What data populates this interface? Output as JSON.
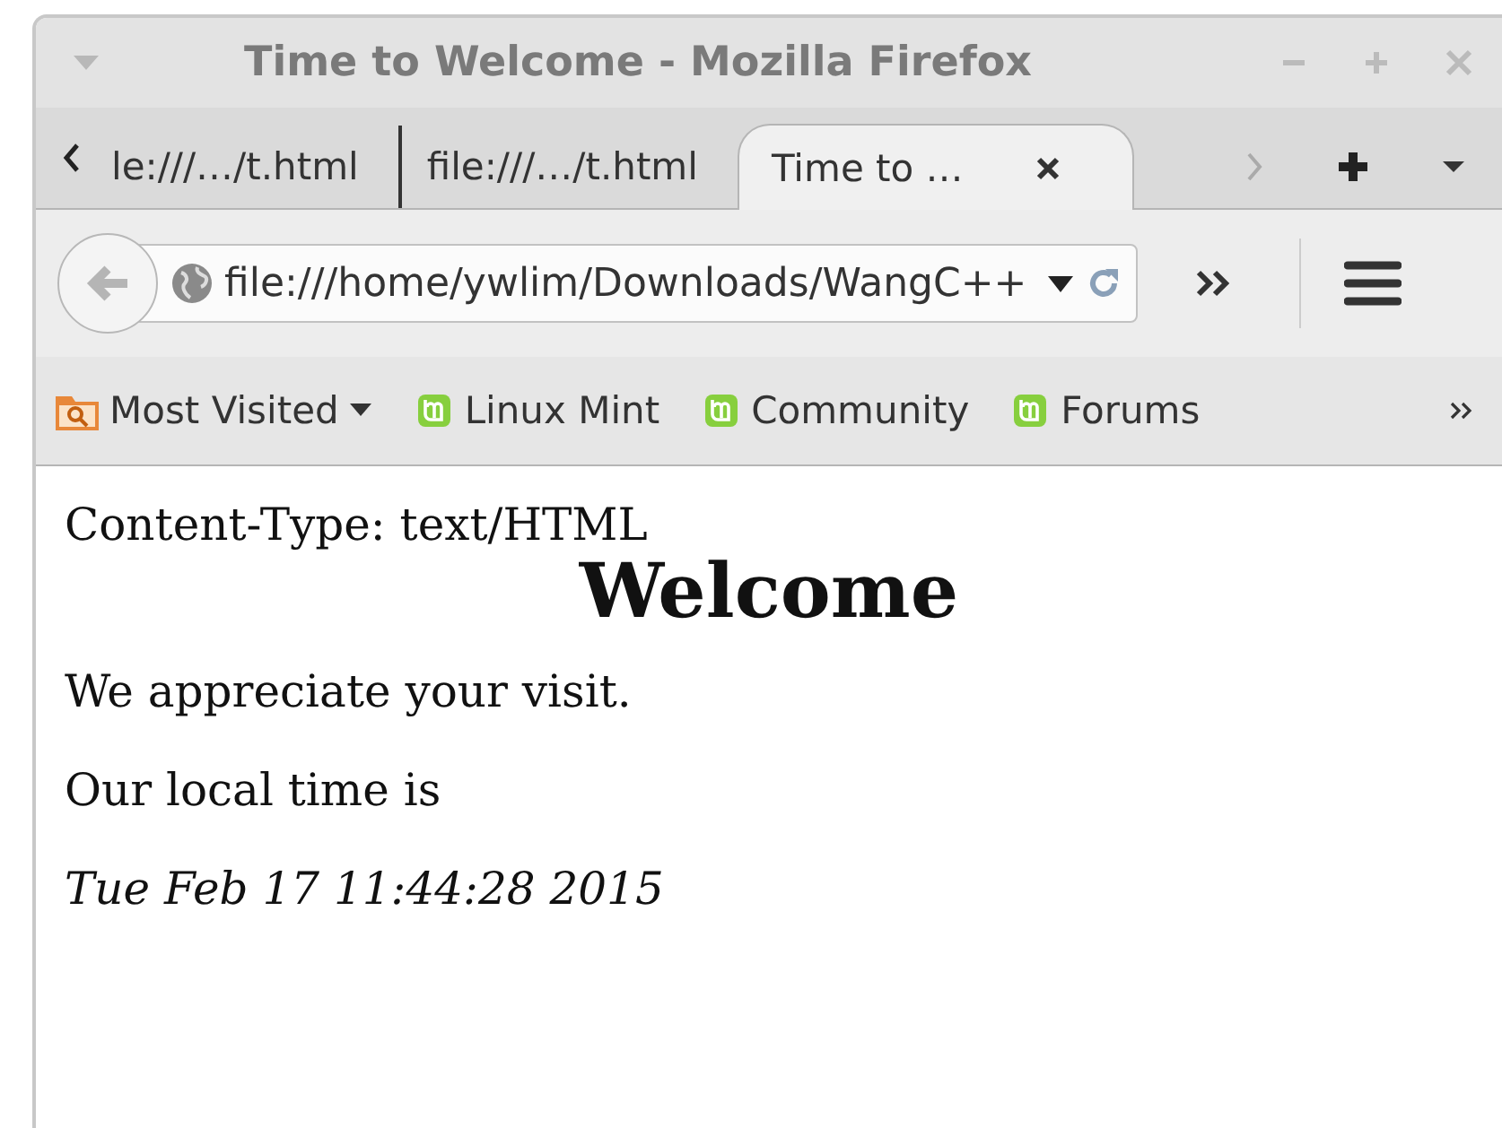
{
  "window": {
    "title": "Time to Welcome - Mozilla Firefox"
  },
  "tabs": [
    {
      "label": "le:///…/t.html",
      "selected": false
    },
    {
      "label": "file:///…/t.html",
      "selected": false
    },
    {
      "label": "Time to …",
      "selected": true
    }
  ],
  "address": {
    "value": "file:///home/ywlim/Downloads/WangC++"
  },
  "bookmarks": [
    {
      "label": "Most Visited",
      "kind": "folder"
    },
    {
      "label": "Linux Mint",
      "kind": "site"
    },
    {
      "label": "Community",
      "kind": "site"
    },
    {
      "label": "Forums",
      "kind": "site"
    }
  ],
  "page": {
    "header_line": "Content-Type: text/HTML",
    "heading": "Welcome",
    "paragraphs": [
      "We appreciate your visit.",
      "Our local time is"
    ],
    "time": "Tue Feb 17 11:44:28 2015"
  }
}
